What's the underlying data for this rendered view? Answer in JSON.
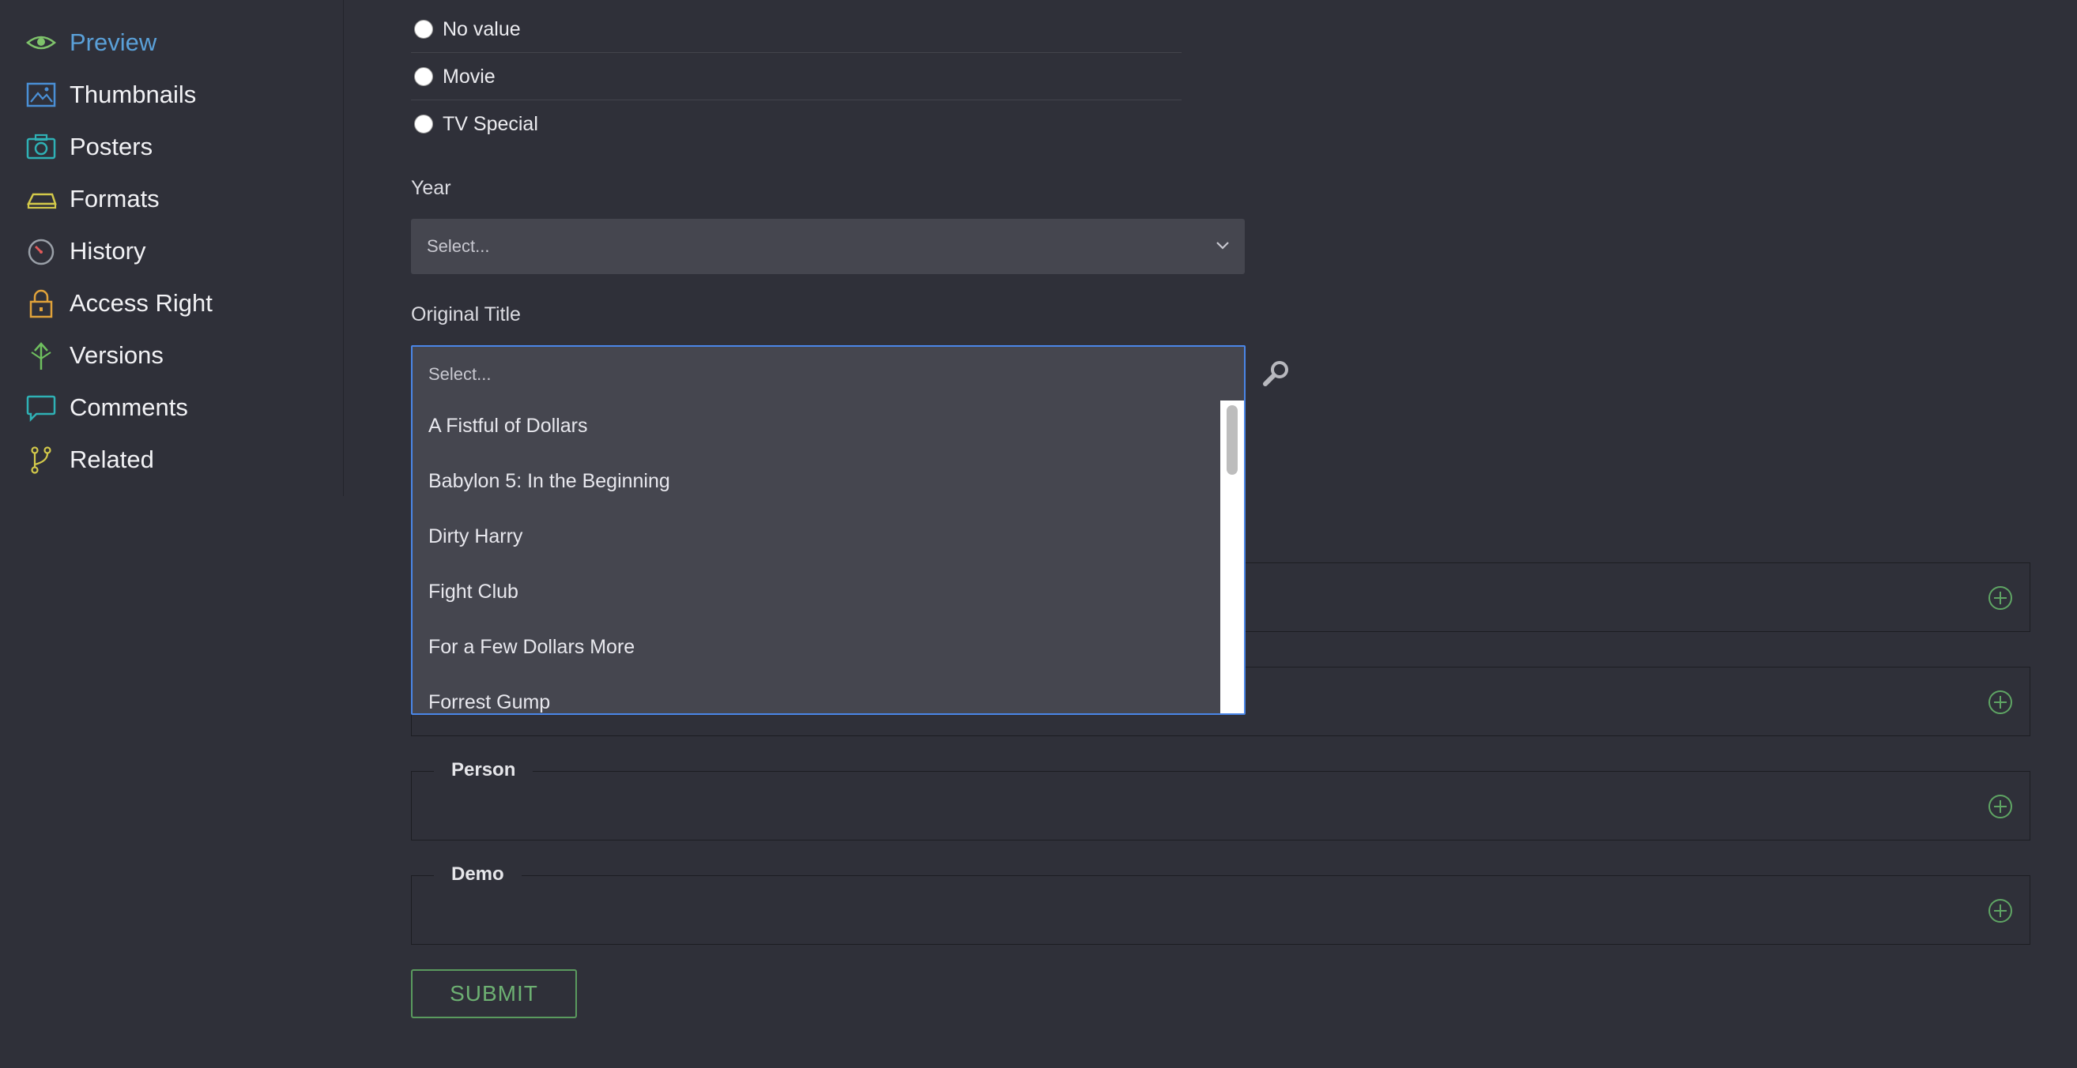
{
  "sidebar": {
    "items": [
      {
        "label": "Preview",
        "icon": "eye-icon"
      },
      {
        "label": "Thumbnails",
        "icon": "image-icon"
      },
      {
        "label": "Posters",
        "icon": "camera-icon"
      },
      {
        "label": "Formats",
        "icon": "formats-icon"
      },
      {
        "label": "History",
        "icon": "clock-icon"
      },
      {
        "label": "Access Right",
        "icon": "lock-icon"
      },
      {
        "label": "Versions",
        "icon": "versions-icon"
      },
      {
        "label": "Comments",
        "icon": "comment-icon"
      },
      {
        "label": "Related",
        "icon": "branch-icon"
      }
    ],
    "active": "Preview"
  },
  "form": {
    "type_options": [
      "No value",
      "Movie",
      "TV Special"
    ],
    "year": {
      "label": "Year",
      "placeholder": "Select..."
    },
    "original_title": {
      "label": "Original Title",
      "placeholder": "Select...",
      "options": [
        "A Fistful of Dollars",
        "Babylon 5: In the Beginning",
        "Dirty Harry",
        "Fight Club",
        "For a Few Dollars More",
        "Forrest Gump"
      ]
    },
    "sections": [
      {
        "legend": ""
      },
      {
        "legend": ""
      },
      {
        "legend": "Person"
      },
      {
        "legend": "Demo"
      }
    ],
    "submit_label": "SUBMIT"
  },
  "colors": {
    "background": "#2f3039",
    "active_nav": "#5aa0d8",
    "focus_border": "#4a86e8",
    "accent_green": "#6db072"
  }
}
